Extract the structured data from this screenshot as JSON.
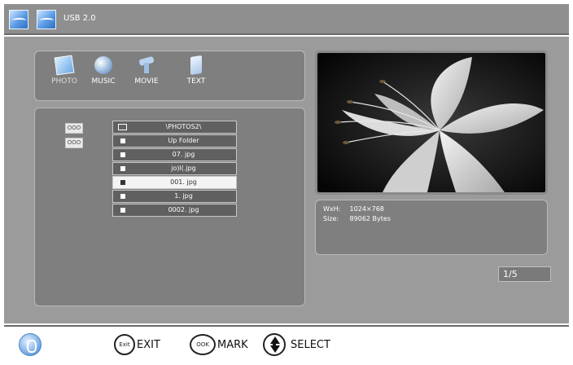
{
  "header": {
    "source_label": "USB 2.0",
    "icons": [
      "usb-drive-icon",
      "usb-drive-icon"
    ]
  },
  "media_tabs": [
    {
      "label": "PHOTO",
      "icon": "photo-icon",
      "active": true
    },
    {
      "label": "MUSIC",
      "icon": "music-icon",
      "active": false
    },
    {
      "label": "MOVIE",
      "icon": "movie-icon",
      "active": false
    },
    {
      "label": "TEXT",
      "icon": "text-icon",
      "active": false
    }
  ],
  "side_buttons": [
    "OOO",
    "OOO"
  ],
  "file_list": {
    "rows": [
      {
        "label": "\\PHOTOS2\\",
        "icon": "folder-path-icon",
        "selected": false
      },
      {
        "label": "Up Folder",
        "icon": "up-folder-icon",
        "selected": false
      },
      {
        "label": "07. jpg",
        "icon": "image-file-icon",
        "selected": false
      },
      {
        "label": "jo)l(.jpg",
        "icon": "image-file-icon",
        "selected": false
      },
      {
        "label": "001. jpg",
        "icon": "image-file-icon",
        "selected": true
      },
      {
        "label": "1. jpg",
        "icon": "image-file-icon",
        "selected": false
      },
      {
        "label": "0002. jpg",
        "icon": "image-file-icon",
        "selected": false
      }
    ]
  },
  "image_info": {
    "size_key": "WxH:",
    "size_value": "1024×768",
    "bytes_key": "Size:",
    "bytes_value": "89062 Bytes"
  },
  "pagination": {
    "text": "1/5"
  },
  "footer": {
    "logo_icon": "brand-logo-icon",
    "exit": {
      "key": "Exit",
      "label": "EXIT"
    },
    "mark": {
      "key": "OOK",
      "label": "MARK"
    },
    "select": {
      "label": "SELECT",
      "icon": "up-down-arrows-icon"
    }
  },
  "colors": {
    "topbar": "#8f8f8f",
    "main_bg": "#9b9b9b",
    "panel_bg": "#7f7f7f",
    "row_bg": "#606060",
    "row_selected_bg": "#f4f4f4",
    "accent_blue": "#5b9be6"
  }
}
